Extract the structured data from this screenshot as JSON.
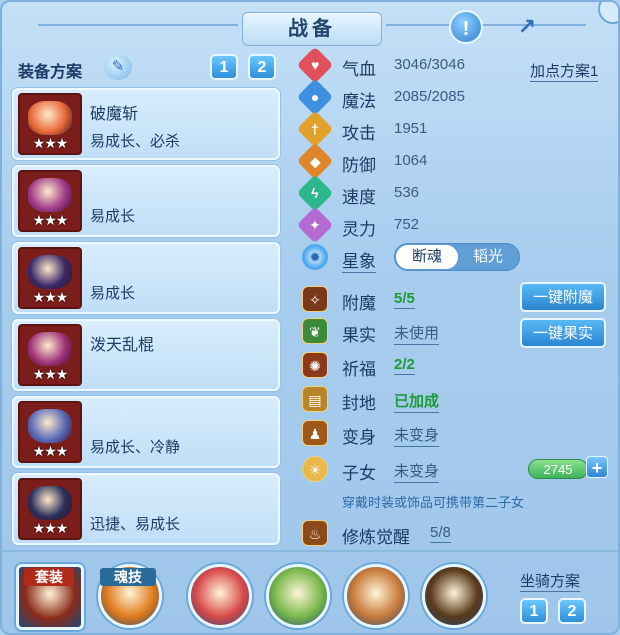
{
  "header": {
    "title": "战备",
    "info_glyph": "!",
    "share_glyph": "↗"
  },
  "equip": {
    "title": "装备方案",
    "plans": [
      "1",
      "2"
    ],
    "items": [
      {
        "name": "破魔斩",
        "trait": "易成长、必杀",
        "stars": "★★★",
        "color": "#e86a3a"
      },
      {
        "name": "",
        "trait": "易成长",
        "stars": "★★★",
        "color": "#a03c8c"
      },
      {
        "name": "",
        "trait": "易成长",
        "stars": "★★★",
        "color": "#3b2b6a"
      },
      {
        "name": "泼天乱棍",
        "trait": "",
        "stars": "★★★",
        "color": "#a0327a"
      },
      {
        "name": "",
        "trait": "易成长、冷静",
        "stars": "★★★",
        "color": "#5a6ab8"
      },
      {
        "name": "",
        "trait": "迅捷、易成长",
        "stars": "★★★",
        "color": "#2a2f5a"
      }
    ]
  },
  "stats": {
    "plan_link": "加点方案1",
    "rows": [
      {
        "label": "气血",
        "value": "3046/3046",
        "icon": "heart-icon",
        "color": "#e2505e",
        "glyph": "♥"
      },
      {
        "label": "魔法",
        "value": "2085/2085",
        "icon": "mana-icon",
        "color": "#3f8fe0",
        "glyph": "●"
      },
      {
        "label": "攻击",
        "value": "1951",
        "icon": "sword-icon",
        "color": "#e0a22a",
        "glyph": "†"
      },
      {
        "label": "防御",
        "value": "1064",
        "icon": "shield-icon",
        "color": "#e0862a",
        "glyph": "◆"
      },
      {
        "label": "速度",
        "value": "536",
        "icon": "speed-icon",
        "color": "#2ab88c",
        "glyph": "ϟ"
      },
      {
        "label": "灵力",
        "value": "752",
        "icon": "spirit-icon",
        "color": "#b46ad0",
        "glyph": "✦"
      }
    ],
    "constellation": {
      "label": "星象",
      "options": [
        "断魂",
        "韬光"
      ],
      "color": "#4ea8f0",
      "glyph": "✹"
    },
    "actions": [
      {
        "label": "附魔",
        "value": "5/5",
        "icon": "enchant-icon",
        "color": "#7a3a1a",
        "glyph": "✧"
      },
      {
        "label": "果实",
        "value": "未使用",
        "icon": "fruit-icon",
        "color": "#3c8a3a",
        "glyph": "❦"
      },
      {
        "label": "祈福",
        "value": "2/2",
        "icon": "bless-icon",
        "color": "#8a3a1a",
        "glyph": "✺"
      },
      {
        "label": "封地",
        "value": "已加成",
        "icon": "fief-icon",
        "color": "#b8862a",
        "glyph": "▤"
      },
      {
        "label": "变身",
        "value": "未变身",
        "icon": "transform-icon",
        "color": "#a0581a",
        "glyph": "♟"
      },
      {
        "label": "子女",
        "value": "未变身",
        "icon": "child-icon",
        "color": "#e8b84a",
        "glyph": "☀"
      }
    ],
    "buttons": {
      "enchant": "一键附魔",
      "fruit": "一键果实"
    },
    "child_counter": "2745",
    "child_hint": "穿戴时装或饰品可携带第二子女",
    "cultivation": {
      "label": "修炼觉醒",
      "value": "5/8",
      "color": "#8a4a1a",
      "glyph": "♨"
    }
  },
  "bottom": {
    "set_label": "套装",
    "soul_label": "魂技",
    "mount_title": "坐骑方案",
    "mount_plans": [
      "1",
      "2"
    ],
    "skills": [
      {
        "icon": "set-icon",
        "color": "#8a2a1a"
      },
      {
        "icon": "soul-skill-icon",
        "color": "#e07a1a"
      },
      {
        "icon": "swirl-skill-icon",
        "color": "#d84a4a"
      },
      {
        "icon": "vine-skill-icon",
        "color": "#7ab84a"
      },
      {
        "icon": "fist-skill-icon",
        "color": "#c87a3a"
      },
      {
        "icon": "blade-skill-icon",
        "color": "#5a3a1a"
      }
    ]
  }
}
